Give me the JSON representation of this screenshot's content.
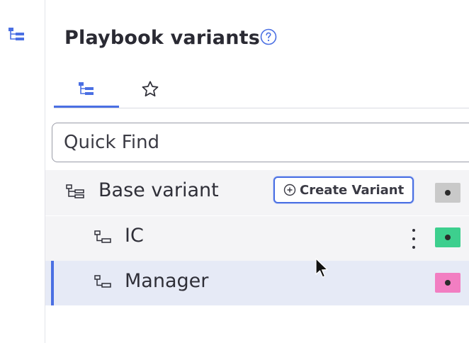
{
  "header": {
    "title": "Playbook variants",
    "help_icon": "help-circle-icon"
  },
  "tabs": [
    {
      "name": "tree",
      "icon": "tree-icon",
      "selected": true
    },
    {
      "name": "favorites",
      "icon": "star-icon",
      "selected": false
    }
  ],
  "search": {
    "placeholder": "Quick Find",
    "value": ""
  },
  "variants": {
    "base": {
      "label": "Base variant",
      "create_button": "Create Variant",
      "swatch_color": "#c9c9c9"
    },
    "ic": {
      "label": "IC",
      "swatch_color": "#3dcf8e"
    },
    "manager": {
      "label": "Manager",
      "swatch_color": "#f27ec2"
    }
  },
  "colors": {
    "accent": "#4a6fe3",
    "selected_row": "#e6eaf6",
    "row": "#f4f4f6"
  }
}
